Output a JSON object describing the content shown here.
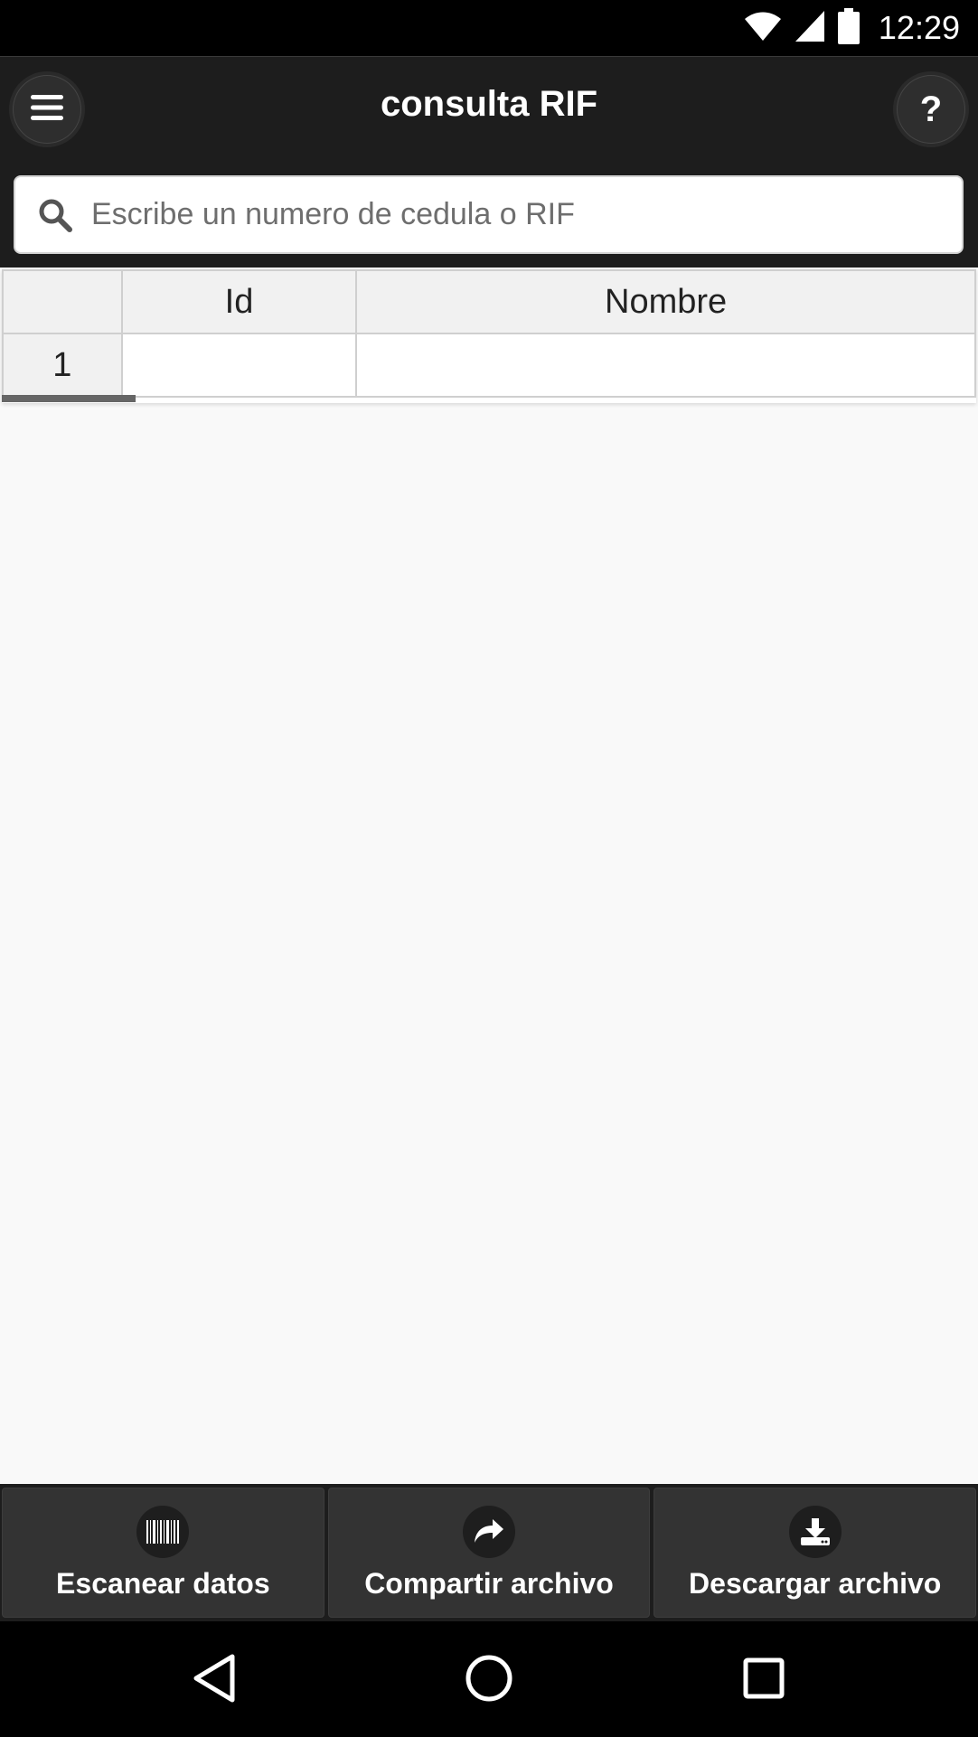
{
  "status_bar": {
    "time": "12:29",
    "icons": [
      "wifi-icon",
      "cell-signal-icon",
      "battery-icon"
    ]
  },
  "header": {
    "title": "consulta RIF",
    "menu_icon": "menu-icon",
    "help_icon": "help-icon",
    "help_glyph": "?"
  },
  "search": {
    "placeholder": "Escribe un numero de cedula o RIF",
    "value": "",
    "icon": "search-icon"
  },
  "table": {
    "columns": [
      "",
      "Id",
      "Nombre"
    ],
    "rows": [
      {
        "num": "1",
        "id": "",
        "nombre": ""
      }
    ]
  },
  "toolbar": {
    "buttons": [
      {
        "label": "Escanear datos",
        "icon": "barcode-icon"
      },
      {
        "label": "Compartir archivo",
        "icon": "share-icon"
      },
      {
        "label": "Descargar archivo",
        "icon": "download-icon"
      }
    ]
  },
  "navbar": {
    "icons": [
      "back-icon",
      "home-icon",
      "recents-icon"
    ]
  },
  "colors": {
    "header_bg": "#1d1d1d",
    "page_bg": "#f9f9f9",
    "toolbar_button_bg": "#333333"
  }
}
